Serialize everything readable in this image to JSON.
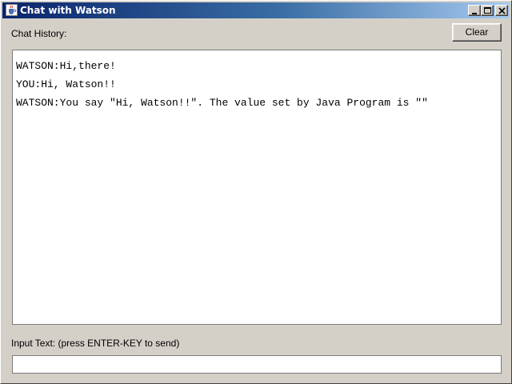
{
  "window": {
    "title": "Chat with Watson",
    "icon": "java-cup-icon",
    "controls": [
      "minimize-icon",
      "maximize-icon",
      "close-icon"
    ]
  },
  "history": {
    "label": "Chat History:",
    "clear_label": "Clear",
    "lines": [
      "WATSON:Hi,there!",
      "YOU:Hi, Watson!!",
      "WATSON:You say \"Hi, Watson!!\". The value set by Java Program is \"\""
    ]
  },
  "input": {
    "label": "Input Text:  (press ENTER-KEY to send)",
    "value": ""
  },
  "colors": {
    "window_bg": "#d4d0c8",
    "title_gradient_start": "#0a246a",
    "title_gradient_end": "#a6caf0",
    "title_text": "#ffffff"
  }
}
